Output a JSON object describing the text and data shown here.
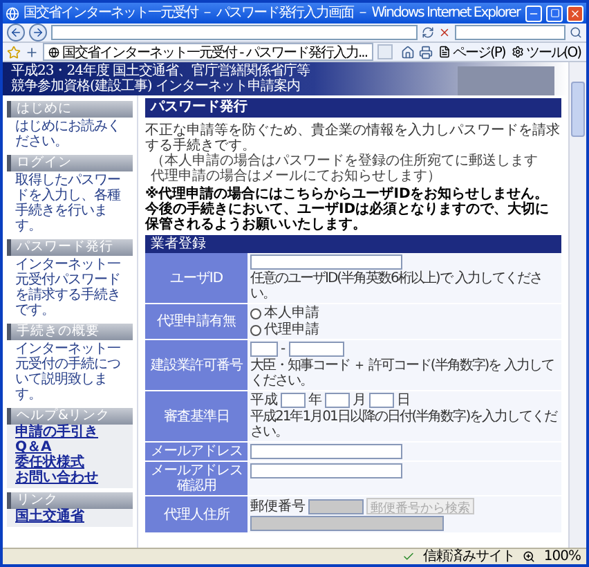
{
  "window": {
    "title": "国交省インターネット一元受付 － パスワード発行入力画面 － Windows Internet Explorer"
  },
  "tab": {
    "label": "国交省インターネット一元受付 - パスワード発行入力...",
    "selected": true
  },
  "toolbar": {
    "menus": [
      "ページ(P)",
      "ツール(O)"
    ]
  },
  "banner": {
    "lines": [
      "平成23・24年度 国土交通省、官庁営繕関係省庁等",
      "競争参加資格(建設工事) インターネット申請案内"
    ]
  },
  "sidebar": {
    "sections": [
      {
        "title": "はじめに",
        "text": "はじめにお読みください。"
      },
      {
        "title": "ログイン",
        "text": "取得したパスワードを入力し、各種手続きを行います。"
      },
      {
        "title": "パスワード発行",
        "text": "インターネット一元受付パスワードを請求する手続きです。"
      },
      {
        "title": "手続きの概要",
        "text": "インターネット一元受付の手続について説明致します。"
      }
    ],
    "link_groups": [
      {
        "title": "ヘルプ&リンク",
        "links": [
          "申請の手引き",
          "Q＆A",
          "委任状様式",
          "お問い合わせ"
        ]
      },
      {
        "title": "リンク",
        "links": [
          "国土交通省"
        ]
      }
    ]
  },
  "main": {
    "heading": "パスワード発行",
    "intro": "不正な申請等を防ぐため、貴企業の情報を入力しパスワードを請求する手続きです。",
    "notes": [
      "（本人申請の場合はパスワードを登録の住所宛てに郵送します",
      "代理申請の場合はメールにてお知らせします）"
    ],
    "warning": "※代理申請の場合にはこちらからユーザIDをお知らせしません。今後の手続きにおいて、ユーザIDは必須となりますので、大切に保管されるようお願いいたします。",
    "form": {
      "title": "業者登録",
      "rows": [
        {
          "label": "ユーザID",
          "kind": "text",
          "hint": "任意のユーザID(半角英数6桁以上)で 入力してください。"
        },
        {
          "label": "代理申請有無",
          "kind": "radio",
          "options": [
            {
              "label": "本人申請",
              "selected": false
            },
            {
              "label": "代理申請",
              "selected": false
            }
          ]
        },
        {
          "label": "建設業許可番号",
          "kind": "permit",
          "separator": "-",
          "hint": "大臣・知事コード ＋ 許可コード(半角数字)を 入力してください。"
        },
        {
          "label": "審査基準日",
          "kind": "date",
          "era": "平成",
          "units": [
            "年",
            "月",
            "日"
          ],
          "hint": "平成21年1月01日以降の日付(半角数字)を入力してください。"
        },
        {
          "label": "メールアドレス",
          "kind": "text"
        },
        {
          "label": "メールアドレス確認用",
          "kind": "text"
        },
        {
          "label": "代理人住所",
          "kind": "address",
          "postal_label": "郵便番号",
          "button": "郵便番号から検索",
          "disabled": true
        }
      ]
    }
  },
  "status_bar": {
    "zone": "信頼済みサイト",
    "zoom": "100%"
  }
}
